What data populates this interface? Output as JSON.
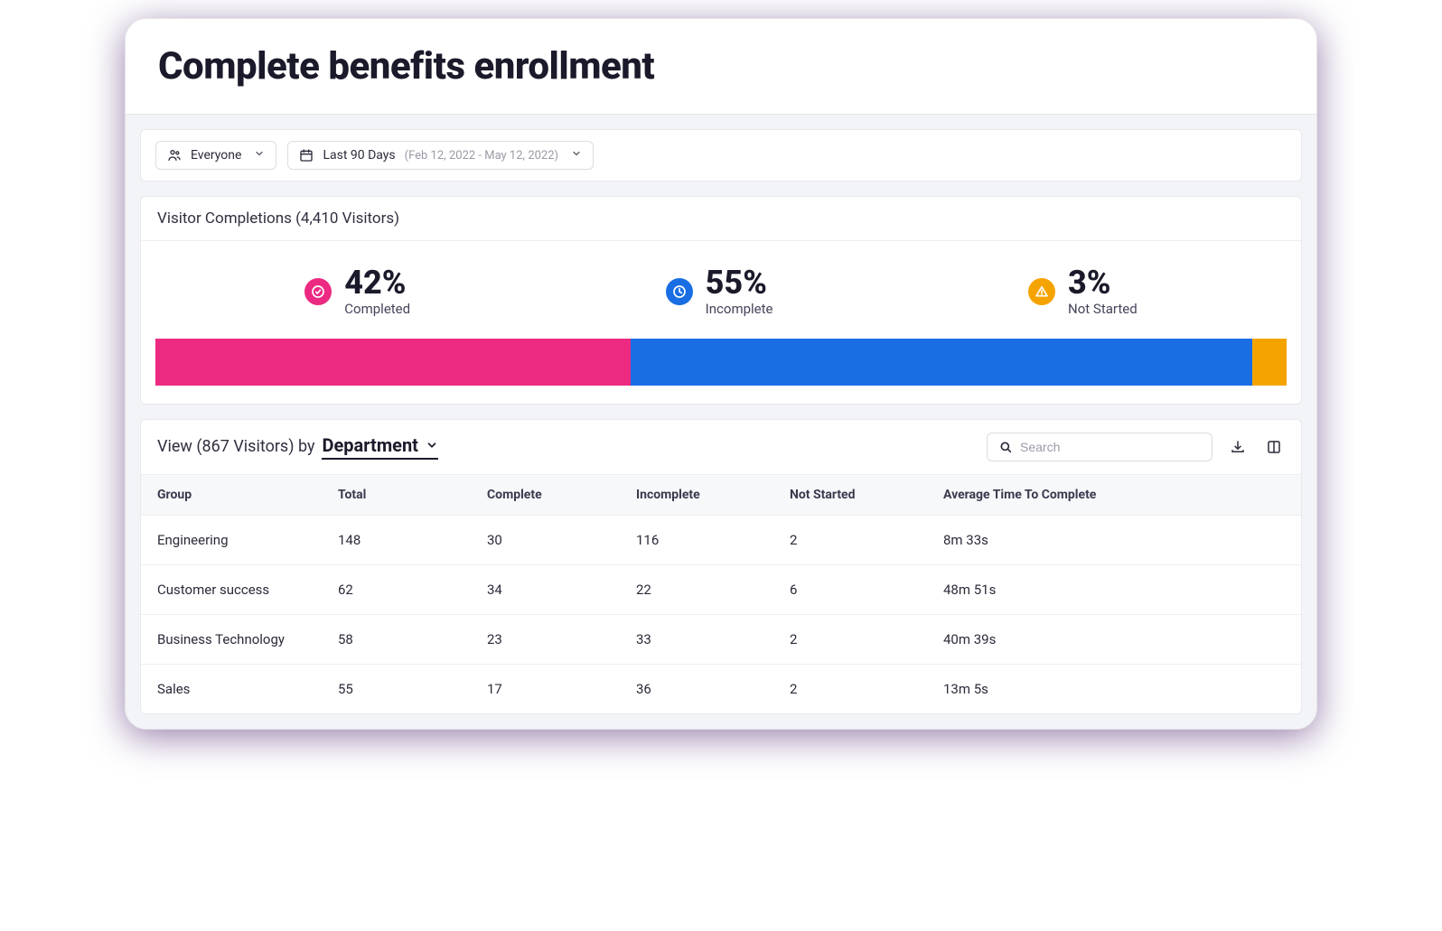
{
  "page": {
    "title": "Complete benefits enrollment"
  },
  "filters": {
    "segment": {
      "label": "Everyone"
    },
    "daterange": {
      "label": "Last 90 Days",
      "sub": "(Feb 12, 2022 - May 12, 2022)"
    }
  },
  "completions": {
    "header": "Visitor Completions (4,410 Visitors)",
    "stats": {
      "completed": {
        "value": "42%",
        "label": "Completed",
        "color": "#ec2a82"
      },
      "incomplete": {
        "value": "55%",
        "label": "Incomplete",
        "color": "#196ee4"
      },
      "notstarted": {
        "value": "3%",
        "label": "Not Started",
        "color": "#f5a300"
      }
    }
  },
  "chart_data": {
    "type": "bar",
    "orientation": "horizontal-stacked",
    "categories": [
      "Completed",
      "Incomplete",
      "Not Started"
    ],
    "values": [
      42,
      55,
      3
    ],
    "colors": {
      "Completed": "#ec2a82",
      "Incomplete": "#196ee4",
      "Not Started": "#f5a300"
    },
    "title": "Visitor Completions (4,410 Visitors)",
    "total_visitors": 4410,
    "unit": "percent",
    "ylim": [
      0,
      100
    ]
  },
  "table": {
    "view_prefix": "View (867 Visitors) by",
    "by_value": "Department",
    "search_placeholder": "Search",
    "columns": {
      "group": "Group",
      "total": "Total",
      "complete": "Complete",
      "incomplete": "Incomplete",
      "notstarted": "Not Started",
      "avg": "Average Time To Complete"
    },
    "rows": [
      {
        "group": "Engineering",
        "total": "148",
        "complete": "30",
        "incomplete": "116",
        "notstarted": "2",
        "avg": "8m 33s"
      },
      {
        "group": "Customer success",
        "total": "62",
        "complete": "34",
        "incomplete": "22",
        "notstarted": "6",
        "avg": "48m 51s"
      },
      {
        "group": "Business Technology",
        "total": "58",
        "complete": "23",
        "incomplete": "33",
        "notstarted": "2",
        "avg": "40m 39s"
      },
      {
        "group": "Sales",
        "total": "55",
        "complete": "17",
        "incomplete": "36",
        "notstarted": "2",
        "avg": "13m 5s"
      }
    ]
  }
}
